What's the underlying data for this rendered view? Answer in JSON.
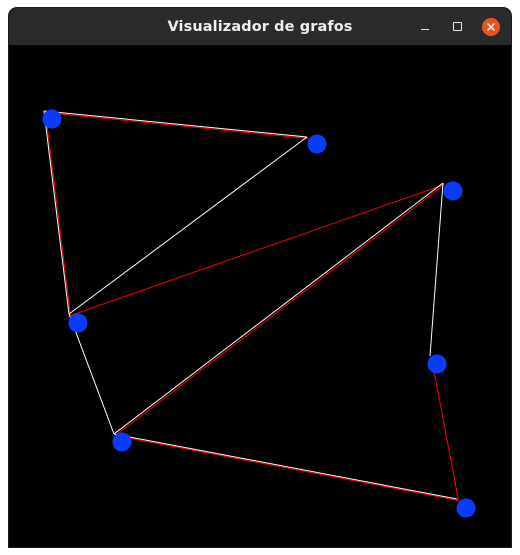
{
  "window": {
    "title": "Visualizador de grafos",
    "controls": [
      {
        "name": "minimize",
        "icon": "minimize-icon"
      },
      {
        "name": "maximize",
        "icon": "maximize-icon"
      },
      {
        "name": "close",
        "icon": "close-icon",
        "color": "#e95420"
      }
    ]
  },
  "colors": {
    "background": "#000000",
    "titlebar": "#2b2b2b",
    "node": "#0a3cff",
    "edge_white": "#ffffff",
    "edge_red": "#ff0000"
  },
  "graph": {
    "nodes": [
      {
        "id": "n1"
      },
      {
        "id": "n2"
      },
      {
        "id": "n3"
      },
      {
        "id": "n4"
      },
      {
        "id": "n5"
      },
      {
        "id": "n6"
      },
      {
        "id": "n7"
      }
    ],
    "edges": [
      {
        "from": "n1",
        "to": "n2",
        "color": "white"
      },
      {
        "from": "n1",
        "to": "n2",
        "color": "red"
      },
      {
        "from": "n1",
        "to": "n4",
        "color": "white"
      },
      {
        "from": "n1",
        "to": "n4",
        "color": "red"
      },
      {
        "from": "n2",
        "to": "n4",
        "color": "white"
      },
      {
        "from": "n3",
        "to": "n4",
        "color": "red"
      },
      {
        "from": "n3",
        "to": "n6",
        "color": "red"
      },
      {
        "from": "n3",
        "to": "n6",
        "color": "white"
      },
      {
        "from": "n3",
        "to": "n5",
        "color": "white"
      },
      {
        "from": "n4",
        "to": "n6",
        "color": "white"
      },
      {
        "from": "n5",
        "to": "n7",
        "color": "red"
      },
      {
        "from": "n6",
        "to": "n7",
        "color": "red"
      },
      {
        "from": "n6",
        "to": "n7",
        "color": "white"
      }
    ]
  }
}
